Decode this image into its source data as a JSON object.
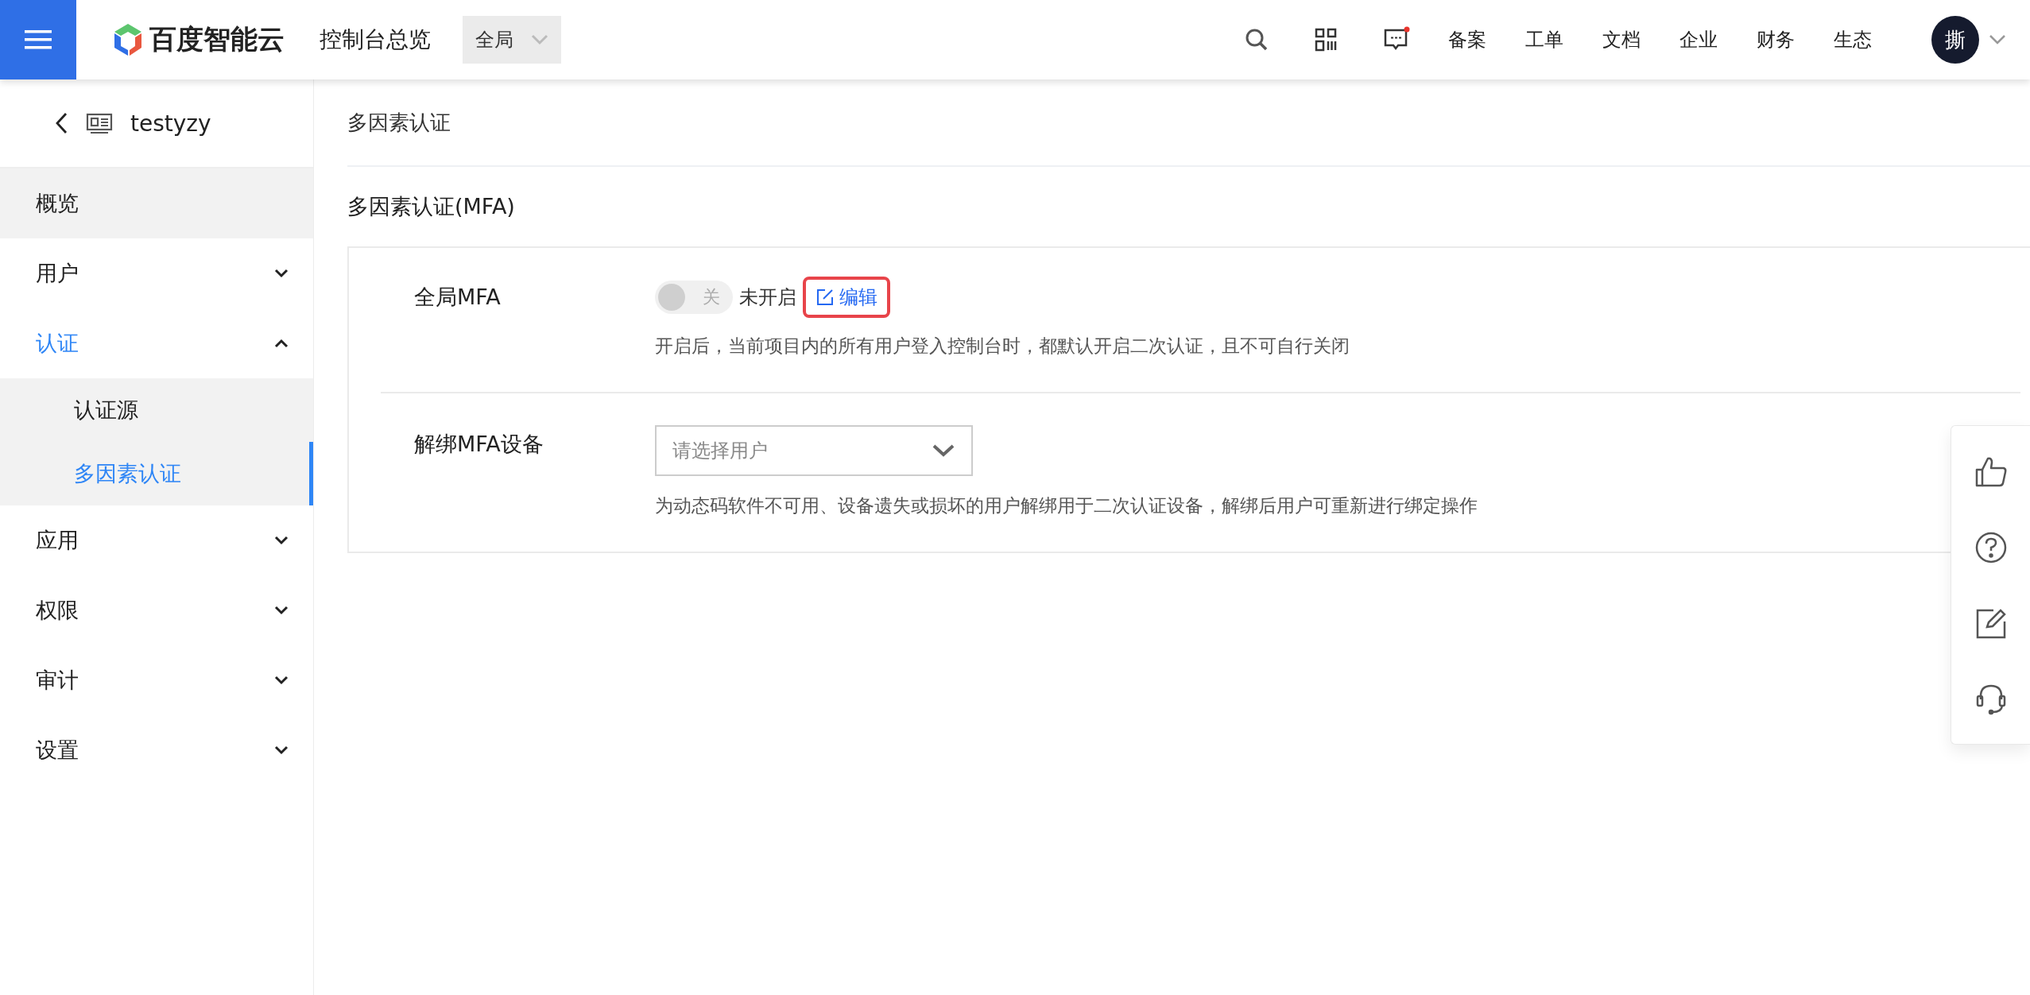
{
  "header": {
    "brand": "百度智能云",
    "title": "控制台总览",
    "scope": "全局",
    "nav": [
      "备案",
      "工单",
      "文档",
      "企业",
      "财务",
      "生态"
    ],
    "message_unread": true,
    "avatar": "撕"
  },
  "sidebar": {
    "back_title": "testyzy",
    "items": [
      {
        "label": "概览",
        "kind": "link",
        "hovered": true,
        "selected": false
      },
      {
        "label": "用户",
        "kind": "group",
        "hovered": false,
        "selected": false,
        "expanded": false
      },
      {
        "label": "认证",
        "kind": "group",
        "hovered": false,
        "selected": true,
        "expanded": true,
        "children": [
          {
            "label": "认证源",
            "selected": false
          },
          {
            "label": "多因素认证",
            "selected": true
          }
        ]
      },
      {
        "label": "应用",
        "kind": "group",
        "hovered": false,
        "selected": false,
        "expanded": false
      },
      {
        "label": "权限",
        "kind": "group",
        "hovered": false,
        "selected": false,
        "expanded": false
      },
      {
        "label": "审计",
        "kind": "group",
        "hovered": false,
        "selected": false,
        "expanded": false
      },
      {
        "label": "设置",
        "kind": "group",
        "hovered": false,
        "selected": false,
        "expanded": false
      }
    ]
  },
  "page_title": "多因素认证",
  "section_title": "多因素认证(MFA)",
  "fields": [
    {
      "kind": "switch",
      "label": "全局MFA",
      "switch": {
        "on": false,
        "label": "关"
      },
      "status": "未开启",
      "edit_link": {
        "label": "编辑",
        "highlighted": true
      },
      "hint": "开启后，当前项目内的所有用户登入控制台时，都默认开启二次认证，且不可自行关闭"
    },
    {
      "kind": "select",
      "label": "解绑MFA设备",
      "placeholder": "请选择用户",
      "hint": "为动态码软件不可用、设备遗失或损坏的用户解绑用于二次认证设备，解绑后用户可重新进行绑定操作"
    }
  ]
}
